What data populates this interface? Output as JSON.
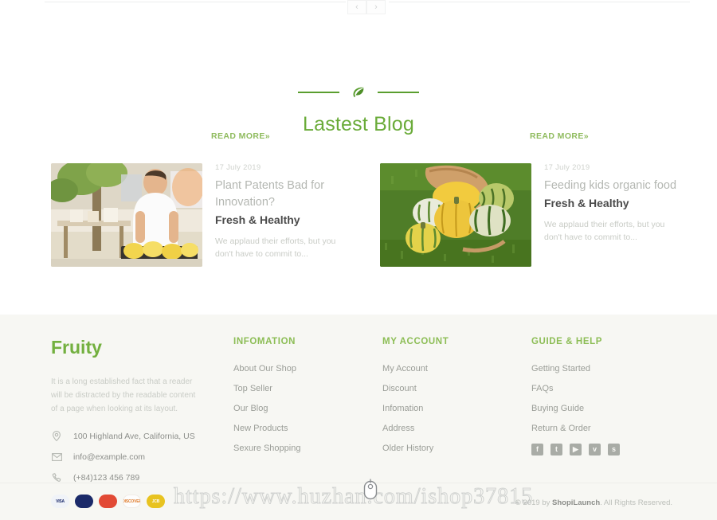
{
  "carousel": {
    "prev_label": "‹",
    "next_label": "›"
  },
  "blog": {
    "section_title": "Lastest Blog",
    "divider_icon": "leaf-icon",
    "posts": [
      {
        "date": "17 July 2019",
        "heading": "Plant Patents Bad for Innovation?",
        "subheading": "Fresh & Healthy",
        "excerpt": "We applaud their efforts, but you don't have to commit to...",
        "read_more": "READ MORE»",
        "image_alt": "market-vendor-photo"
      },
      {
        "date": "17 July 2019",
        "heading": "Feeding kids organic food",
        "subheading": "Fresh & Healthy",
        "excerpt": "We applaud their efforts, but you don't have to commit to...",
        "read_more": "READ MORE»",
        "image_alt": "squash-basket-photo"
      }
    ]
  },
  "footer": {
    "brand": "Fruity",
    "description": "It is a long established fact that a reader will be distracted by the readable content of a page when looking at its layout.",
    "contacts": [
      {
        "icon": "location-pin-icon",
        "text": "100 Highland Ave, California, US"
      },
      {
        "icon": "envelope-icon",
        "text": "info@example.com"
      },
      {
        "icon": "phone-icon",
        "text": "(+84)123 456 789"
      }
    ],
    "columns": [
      {
        "heading": "INFOMATION",
        "links": [
          "About Our Shop",
          "Top Seller",
          "Our Blog",
          "New Products",
          "Sexure Shopping"
        ]
      },
      {
        "heading": "MY ACCOUNT",
        "links": [
          "My Account",
          "Discount",
          "Infomation",
          "Address",
          "Older History"
        ]
      },
      {
        "heading": "GUIDE & HELP",
        "links": [
          "Getting Started",
          "FAQs",
          "Buying Guide",
          "Return & Order"
        ]
      }
    ],
    "socials": [
      {
        "name": "facebook-icon",
        "glyph": "f"
      },
      {
        "name": "twitter-icon",
        "glyph": "t"
      },
      {
        "name": "youtube-icon",
        "glyph": "▶"
      },
      {
        "name": "vimeo-icon",
        "glyph": "v"
      },
      {
        "name": "skype-icon",
        "glyph": "s"
      }
    ]
  },
  "bottom": {
    "payments": [
      {
        "name": "visa",
        "label": "VISA",
        "color": "#f0f3f8",
        "text_color": "#1a2a6b"
      },
      {
        "name": "maestro",
        "label": "",
        "color": "#1b2a69",
        "text_color": "#ffffff"
      },
      {
        "name": "mastercard",
        "label": "",
        "color": "#e24a35",
        "text_color": "#ffffff"
      },
      {
        "name": "discover",
        "label": "DISCOVER",
        "color": "#fdfdfd",
        "text_color": "#e07b2a"
      },
      {
        "name": "jcb",
        "label": "JCB",
        "color": "#e8c320",
        "text_color": "#ffffff"
      }
    ],
    "copyright_prefix": "© 2019 by ",
    "copyright_brand": "ShopiLaunch",
    "copyright_suffix": ". All Rights Reserved."
  },
  "watermark": {
    "text": "https://www.huzhan.com/ishop37815",
    "cursor_icon": "mouse-cursor-icon"
  },
  "colors": {
    "accent_green": "#6aab39",
    "brand_green": "#73b03f",
    "footer_bg": "#f7f7f3",
    "muted_text": "#9b9e98"
  }
}
